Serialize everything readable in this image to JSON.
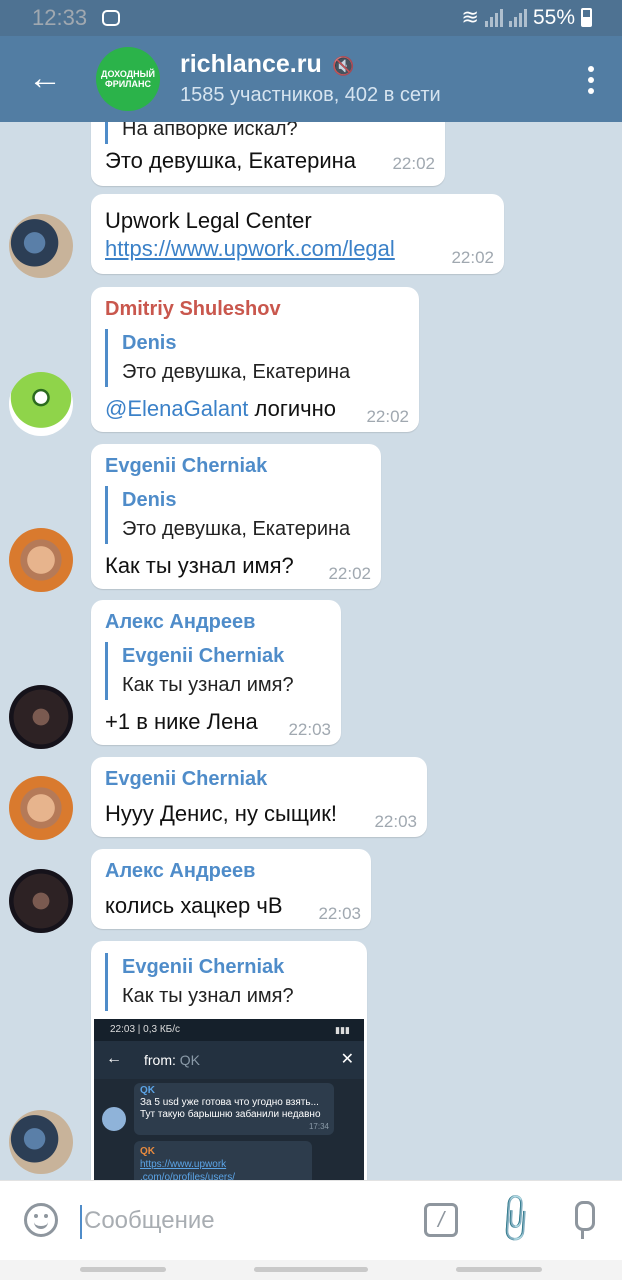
{
  "status_bar": {
    "time": "12:33",
    "battery": "55%"
  },
  "header": {
    "back_icon": "arrow-left-icon",
    "logo_text": "ДОХОДНЫЙ ФРИЛАНС",
    "title": "richlance.ru",
    "subtitle": "1585 участников, 402 в сети",
    "menu_icon": "more-vert-icon"
  },
  "messages": [
    {
      "quote_text": "На апворке искал?",
      "text": "Это девушка, Екатерина",
      "time": "22:02"
    },
    {
      "text": "Upwork Legal Center",
      "link": "https://www.upwork.com/legal",
      "time": "22:02"
    },
    {
      "sender": "Dmitriy Shuleshov",
      "sender_color": "#c9574d",
      "quote_name": "Denis",
      "quote_text": "Это девушка, Екатерина",
      "mention": "@ElenaGalant",
      "text": " логично",
      "time": "22:02"
    },
    {
      "sender": "Evgenii Cherniak",
      "sender_color": "#4f8cc9",
      "quote_name": "Denis",
      "quote_text": "Это девушка, Екатерина",
      "text": "Как ты узнал имя?",
      "time": "22:02"
    },
    {
      "sender": "Алекс Андреев",
      "sender_color": "#4f8cc9",
      "quote_name": "Evgenii Cherniak",
      "quote_text": "Как ты узнал имя?",
      "text": "+1 в нике Лена",
      "time": "22:03"
    },
    {
      "sender": "Evgenii Cherniak",
      "sender_color": "#4f8cc9",
      "text": "Нууу Денис, ну сыщик!",
      "time": "22:03"
    },
    {
      "sender": "Алекс Андреев",
      "sender_color": "#4f8cc9",
      "text": "колись хацкер чВ",
      "time": "22:03"
    },
    {
      "quote_name": "Evgenii Cherniak",
      "quote_text": "Как ты узнал имя?"
    }
  ],
  "embedded_screenshot": {
    "status_time": "22:03 | 0,3 КБ/с",
    "search_prefix": "from:",
    "search_value": "QK",
    "msg1_sender": "QK",
    "msg1_quote": "За 5 usd уже готова что угодно взять...",
    "msg1_text": "Тут такую барышню забанили недавно",
    "msg1_time": "17:34",
    "msg2_sender": "QK",
    "msg2_link": "https://www.upwork .com/o/profiles/users/"
  },
  "input": {
    "placeholder": "Сообщение"
  }
}
